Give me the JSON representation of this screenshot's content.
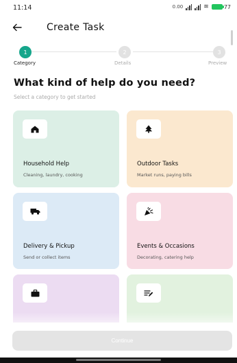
{
  "status_bar": {
    "time": "11:14",
    "net_speed": "0.00",
    "battery": "77",
    "battery_color": "#22c55e"
  },
  "header": {
    "back_icon": "arrow-left-icon",
    "title": "Create Task"
  },
  "stepper": {
    "steps": [
      {
        "number": "1",
        "label": "Category",
        "state": "active"
      },
      {
        "number": "2",
        "label": "Details",
        "state": "inactive"
      },
      {
        "number": "3",
        "label": "Preview",
        "state": "inactive"
      }
    ],
    "active_color": "#15a68b"
  },
  "main": {
    "heading": "What kind of help do you need?",
    "subheading": "Select a category to get started"
  },
  "categories": [
    {
      "title": "Household Help",
      "description": "Cleaning, laundry, cooking",
      "icon": "house-icon",
      "color": "#dcefe6"
    },
    {
      "title": "Outdoor Tasks",
      "description": "Market runs, paying bills",
      "icon": "tree-icon",
      "color": "#fbe8cf"
    },
    {
      "title": "Delivery & Pickup",
      "description": "Send or collect items",
      "icon": "truck-icon",
      "color": "#dceaf6"
    },
    {
      "title": "Events & Occasions",
      "description": "Decorating, catering help",
      "icon": "party-popper-icon",
      "color": "#f8dce4"
    },
    {
      "title": "",
      "description": "",
      "icon": "briefcase-icon",
      "color": "#ecdcf2"
    },
    {
      "title": "",
      "description": "",
      "icon": "edit-list-icon",
      "color": "#e2f2df"
    }
  ],
  "footer": {
    "continue_label": "Continue"
  }
}
